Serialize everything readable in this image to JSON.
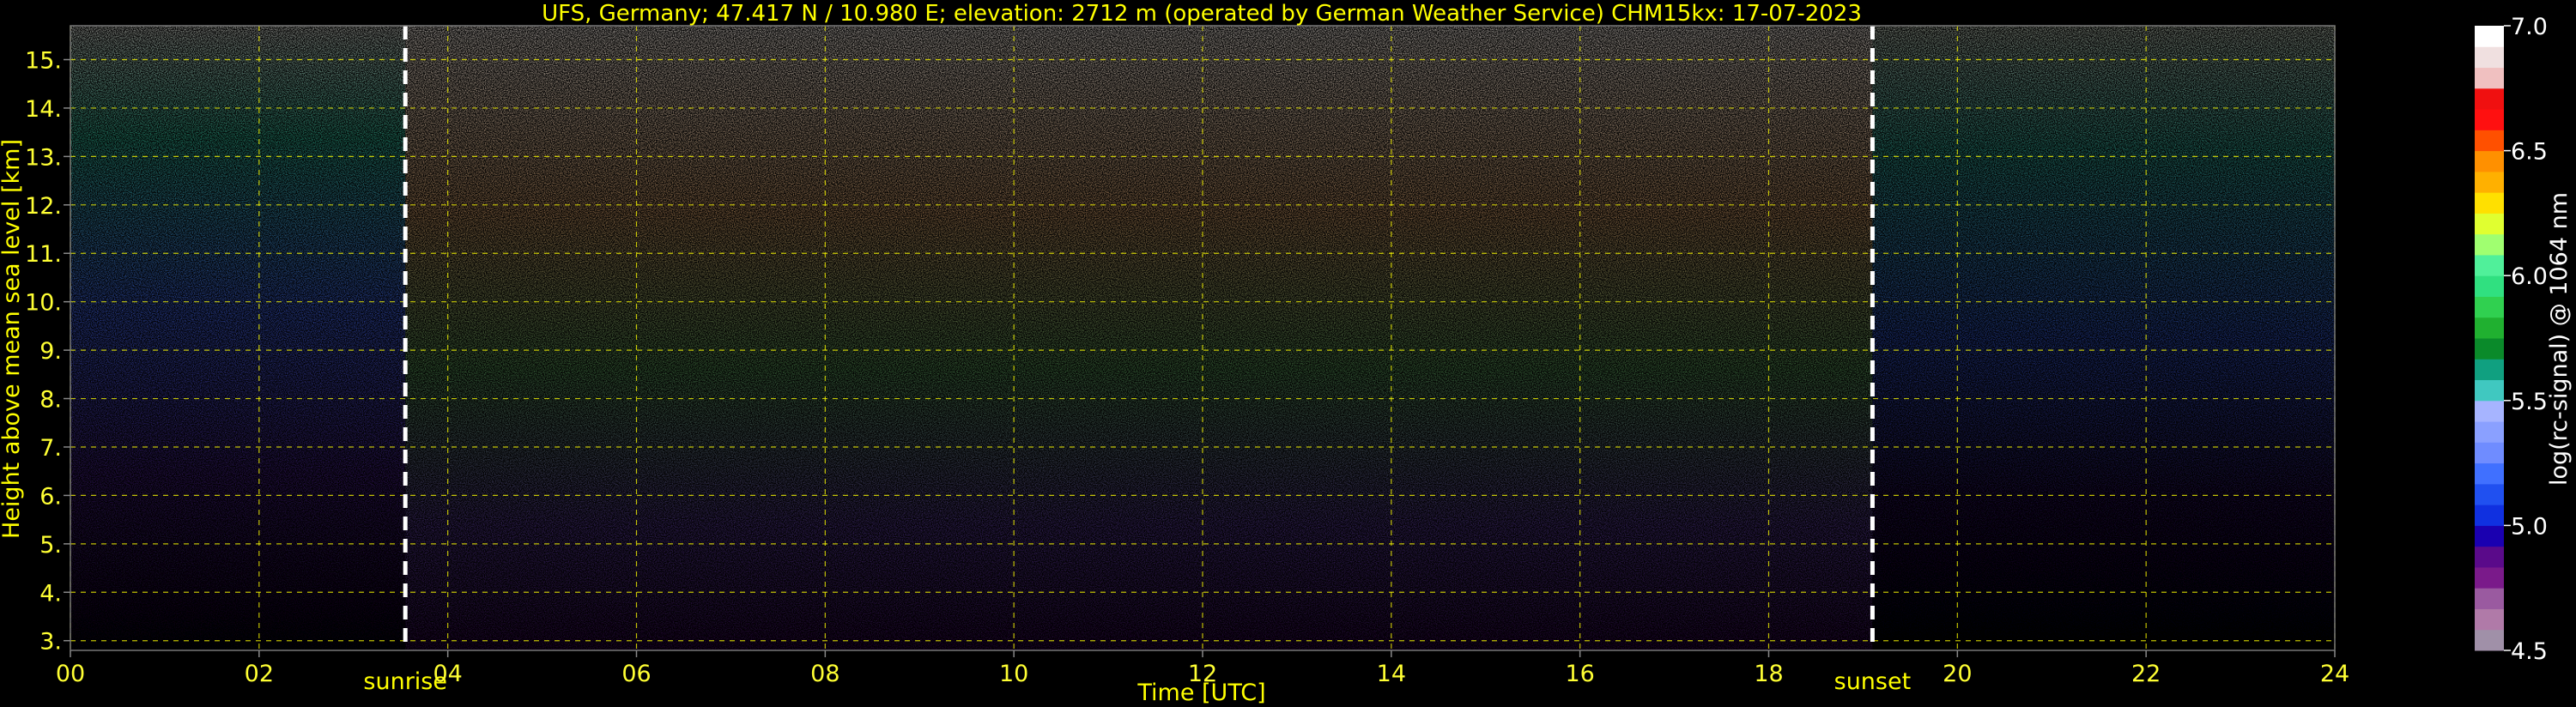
{
  "chart_data": {
    "type": "heatmap",
    "title": "UFS, Germany; 47.417 N / 10.980 E; elevation: 2712 m  (operated by German Weather Service)    CHM15kx: 17-07-2023",
    "xlabel": "Time [UTC]",
    "ylabel": "Height above mean sea level [km]",
    "xlim": [
      0,
      24
    ],
    "ylim": [
      2.8,
      15.7
    ],
    "x_ticks": [
      0,
      2,
      4,
      6,
      8,
      10,
      12,
      14,
      16,
      18,
      20,
      22,
      24
    ],
    "x_tick_labels": [
      "00",
      "02",
      "04",
      "06",
      "08",
      "10",
      "12",
      "14",
      "16",
      "18",
      "20",
      "22",
      "24"
    ],
    "y_ticks": [
      3,
      4,
      5,
      6,
      7,
      8,
      9,
      10,
      11,
      12,
      13,
      14,
      15
    ],
    "y_tick_labels": [
      "3.",
      "4.",
      "5.",
      "6.",
      "7.",
      "8.",
      "9.",
      "10.",
      "11.",
      "12.",
      "13.",
      "14.",
      "15."
    ],
    "grid": true,
    "annotations": [
      {
        "text": "sunrise",
        "x": 3.55
      },
      {
        "text": "sunset",
        "x": 19.1
      }
    ],
    "colorbar": {
      "label": "log(rc-signal) @ 1064 nm",
      "range": [
        4.5,
        7.0
      ],
      "ticks": [
        4.5,
        5.0,
        5.5,
        6.0,
        6.5,
        7.0
      ],
      "tick_labels": [
        "4.5",
        "5.0",
        "5.5",
        "6.0",
        "6.5",
        "7.0"
      ],
      "colors": [
        "#a090a8",
        "#b07aa8",
        "#9a5aa0",
        "#7a1a8a",
        "#5a0a8a",
        "#1a00b0",
        "#1030e0",
        "#2050f0",
        "#4070ff",
        "#6f8cff",
        "#8aa0ff",
        "#a6b4ff",
        "#40c8c0",
        "#10a080",
        "#0a8a2a",
        "#20b030",
        "#30d050",
        "#30e080",
        "#50f09a",
        "#a0ff70",
        "#e0ff30",
        "#ffe000",
        "#ffb000",
        "#ff9000",
        "#ff5000",
        "#ff1010",
        "#f01010",
        "#f0c0c0",
        "#f0e0e0",
        "#ffffff"
      ]
    },
    "colors": {
      "text": "#ffff00",
      "grid": "#ffff00",
      "axes_text": "#ffff33",
      "colorbar_text": "#ffffff",
      "marker": "#ffffff"
    }
  }
}
